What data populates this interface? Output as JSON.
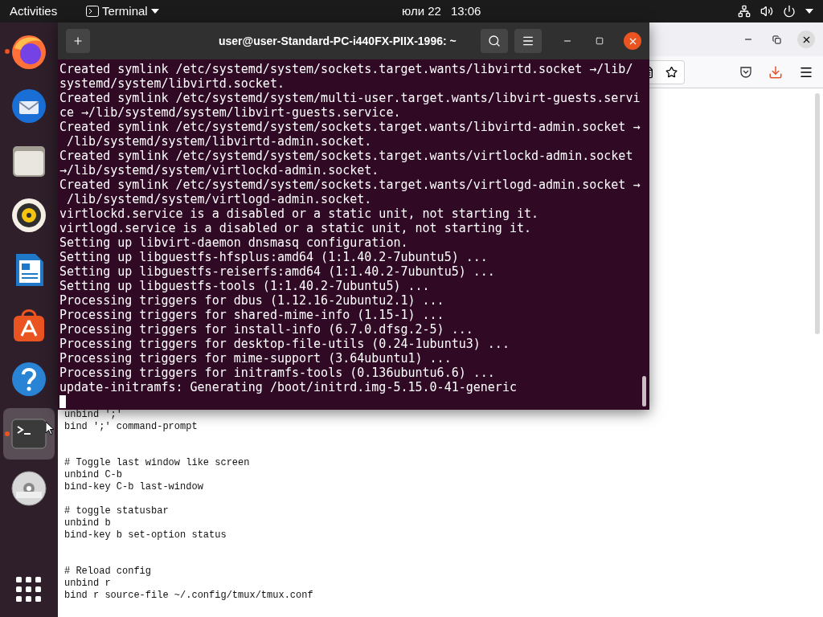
{
  "top_bar": {
    "activities": "Activities",
    "app_menu": "Terminal",
    "date": "юли 22",
    "time": "13:06"
  },
  "dock": [
    {
      "kind": "firefox",
      "running": true,
      "selected": false
    },
    {
      "kind": "mail",
      "running": false,
      "selected": false
    },
    {
      "kind": "files",
      "running": false,
      "selected": false
    },
    {
      "kind": "music",
      "running": false,
      "selected": false
    },
    {
      "kind": "writer",
      "running": false,
      "selected": false
    },
    {
      "kind": "software",
      "running": false,
      "selected": false
    },
    {
      "kind": "help",
      "running": false,
      "selected": false
    },
    {
      "kind": "terminal",
      "running": true,
      "selected": true
    },
    {
      "kind": "dvd",
      "running": false,
      "selected": false
    }
  ],
  "terminal": {
    "title": "user@user-Standard-PC-i440FX-PIIX-1996: ~",
    "lines": [
      "Created symlink /etc/systemd/system/sockets.target.wants/libvirtd.socket →/lib/",
      "systemd/system/libvirtd.socket.",
      "Created symlink /etc/systemd/system/multi-user.target.wants/libvirt-guests.servi",
      "ce →/lib/systemd/system/libvirt-guests.service.",
      "Created symlink /etc/systemd/system/sockets.target.wants/libvirtd-admin.socket →",
      " /lib/systemd/system/libvirtd-admin.socket.",
      "Created symlink /etc/systemd/system/sockets.target.wants/virtlockd-admin.socket",
      "→/lib/systemd/system/virtlockd-admin.socket.",
      "Created symlink /etc/systemd/system/sockets.target.wants/virtlogd-admin.socket →",
      " /lib/systemd/system/virtlogd-admin.socket.",
      "virtlockd.service is a disabled or a static unit, not starting it.",
      "virtlogd.service is a disabled or a static unit, not starting it.",
      "Setting up libvirt-daemon dnsmasq configuration.",
      "Setting up libguestfs-hfsplus:amd64 (1:1.40.2-7ubuntu5) ...",
      "Setting up libguestfs-reiserfs:amd64 (1:1.40.2-7ubuntu5) ...",
      "Setting up libguestfs-tools (1:1.40.2-7ubuntu5) ...",
      "Processing triggers for dbus (1.12.16-2ubuntu2.1) ...",
      "Processing triggers for shared-mime-info (1.15-1) ...",
      "Processing triggers for install-info (6.7.0.dfsg.2-5) ...",
      "Processing triggers for desktop-file-utils (0.24-1ubuntu3) ...",
      "Processing triggers for mime-support (3.64ubuntu1) ...",
      "Processing triggers for initramfs-tools (0.136ubuntu6.6) ...",
      "update-initramfs: Generating /boot/initrd.img-5.15.0-41-generic"
    ]
  },
  "browser": {
    "code_lines": [
      {
        "kind": "code",
        "text": "unbind ';'"
      },
      {
        "kind": "code",
        "text": "bind ';' command-prompt"
      },
      {
        "kind": "blank"
      },
      {
        "kind": "blank"
      },
      {
        "kind": "code",
        "text": "# Toggle last window like screen"
      },
      {
        "kind": "code",
        "text": "unbind C-b"
      },
      {
        "kind": "code",
        "text": "bind-key C-b last-window"
      },
      {
        "kind": "blank"
      },
      {
        "kind": "code",
        "text": "# toggle statusbar"
      },
      {
        "kind": "code",
        "text": "unbind b"
      },
      {
        "kind": "code",
        "text": "bind-key b set-option status"
      },
      {
        "kind": "blank"
      },
      {
        "kind": "blank"
      },
      {
        "kind": "code",
        "text": "# Reload config"
      },
      {
        "kind": "code",
        "text": "unbind r"
      },
      {
        "kind": "code",
        "text": "bind r source-file ~/.config/tmux/tmux.conf"
      }
    ]
  }
}
